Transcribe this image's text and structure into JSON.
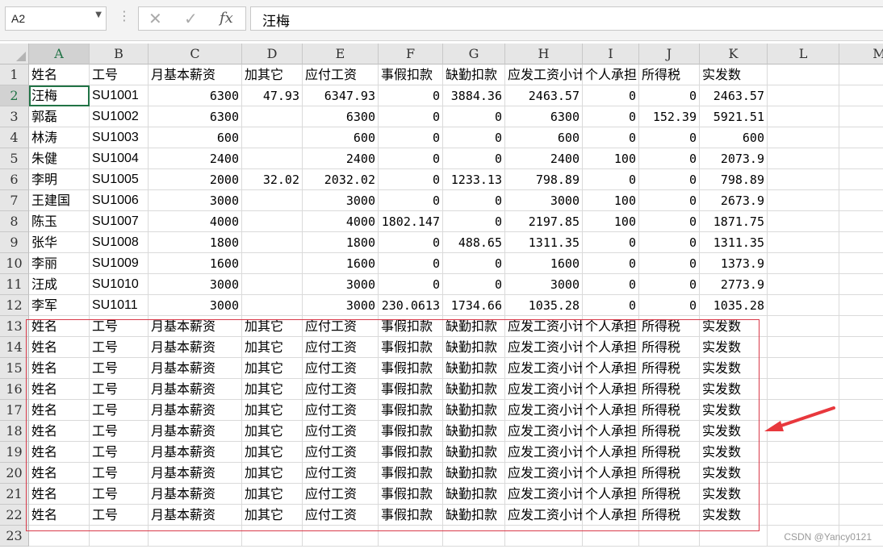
{
  "formula_bar": {
    "name_box": "A2",
    "cancel_icon": "✕",
    "enter_icon": "✓",
    "fx_label": "fx",
    "value": "汪梅"
  },
  "columns": [
    "A",
    "B",
    "C",
    "D",
    "E",
    "F",
    "G",
    "H",
    "I",
    "J",
    "K",
    "L",
    "M"
  ],
  "row_numbers": [
    "1",
    "2",
    "3",
    "4",
    "5",
    "6",
    "7",
    "8",
    "9",
    "10",
    "11",
    "12",
    "13",
    "14",
    "15",
    "16",
    "17",
    "18",
    "19",
    "20",
    "21",
    "22",
    "23"
  ],
  "sheet": {
    "header": [
      "姓名",
      "工号",
      "月基本薪资",
      "加其它",
      "应付工资",
      "事假扣款",
      "缺勤扣款",
      "应发工资小计",
      "个人承担",
      "所得税",
      "实发数"
    ],
    "rows": [
      [
        "汪梅",
        "SU1001",
        "6300",
        "47.93",
        "6347.93",
        "0",
        "3884.36",
        "2463.57",
        "0",
        "0",
        "2463.57"
      ],
      [
        "郭磊",
        "SU1002",
        "6300",
        "",
        "6300",
        "0",
        "0",
        "6300",
        "0",
        "152.39",
        "5921.51"
      ],
      [
        "林涛",
        "SU1003",
        "600",
        "",
        "600",
        "0",
        "0",
        "600",
        "0",
        "0",
        "600"
      ],
      [
        "朱健",
        "SU1004",
        "2400",
        "",
        "2400",
        "0",
        "0",
        "2400",
        "100",
        "0",
        "2073.9"
      ],
      [
        "李明",
        "SU1005",
        "2000",
        "32.02",
        "2032.02",
        "0",
        "1233.13",
        "798.89",
        "0",
        "0",
        "798.89"
      ],
      [
        "王建国",
        "SU1006",
        "3000",
        "",
        "3000",
        "0",
        "0",
        "3000",
        "100",
        "0",
        "2673.9"
      ],
      [
        "陈玉",
        "SU1007",
        "4000",
        "",
        "4000",
        "1802.147",
        "0",
        "2197.85",
        "100",
        "0",
        "1871.75"
      ],
      [
        "张华",
        "SU1008",
        "1800",
        "",
        "1800",
        "0",
        "488.65",
        "1311.35",
        "0",
        "0",
        "1311.35"
      ],
      [
        "李丽",
        "SU1009",
        "1600",
        "",
        "1600",
        "0",
        "0",
        "1600",
        "0",
        "0",
        "1373.9"
      ],
      [
        "汪成",
        "SU1010",
        "3000",
        "",
        "3000",
        "0",
        "0",
        "3000",
        "0",
        "0",
        "2773.9"
      ],
      [
        "李军",
        "SU1011",
        "3000",
        "",
        "3000",
        "230.0613",
        "1734.66",
        "1035.28",
        "0",
        "0",
        "1035.28"
      ]
    ],
    "repeated_header_rows": 10
  },
  "watermark": "CSDN @Yancy0121",
  "colors": {
    "header_bg": "#e6e6e6",
    "gridline": "#dadada",
    "selection": "#217346",
    "annotation_red": "#d93a4a",
    "arrow_red": "#e8383d"
  }
}
